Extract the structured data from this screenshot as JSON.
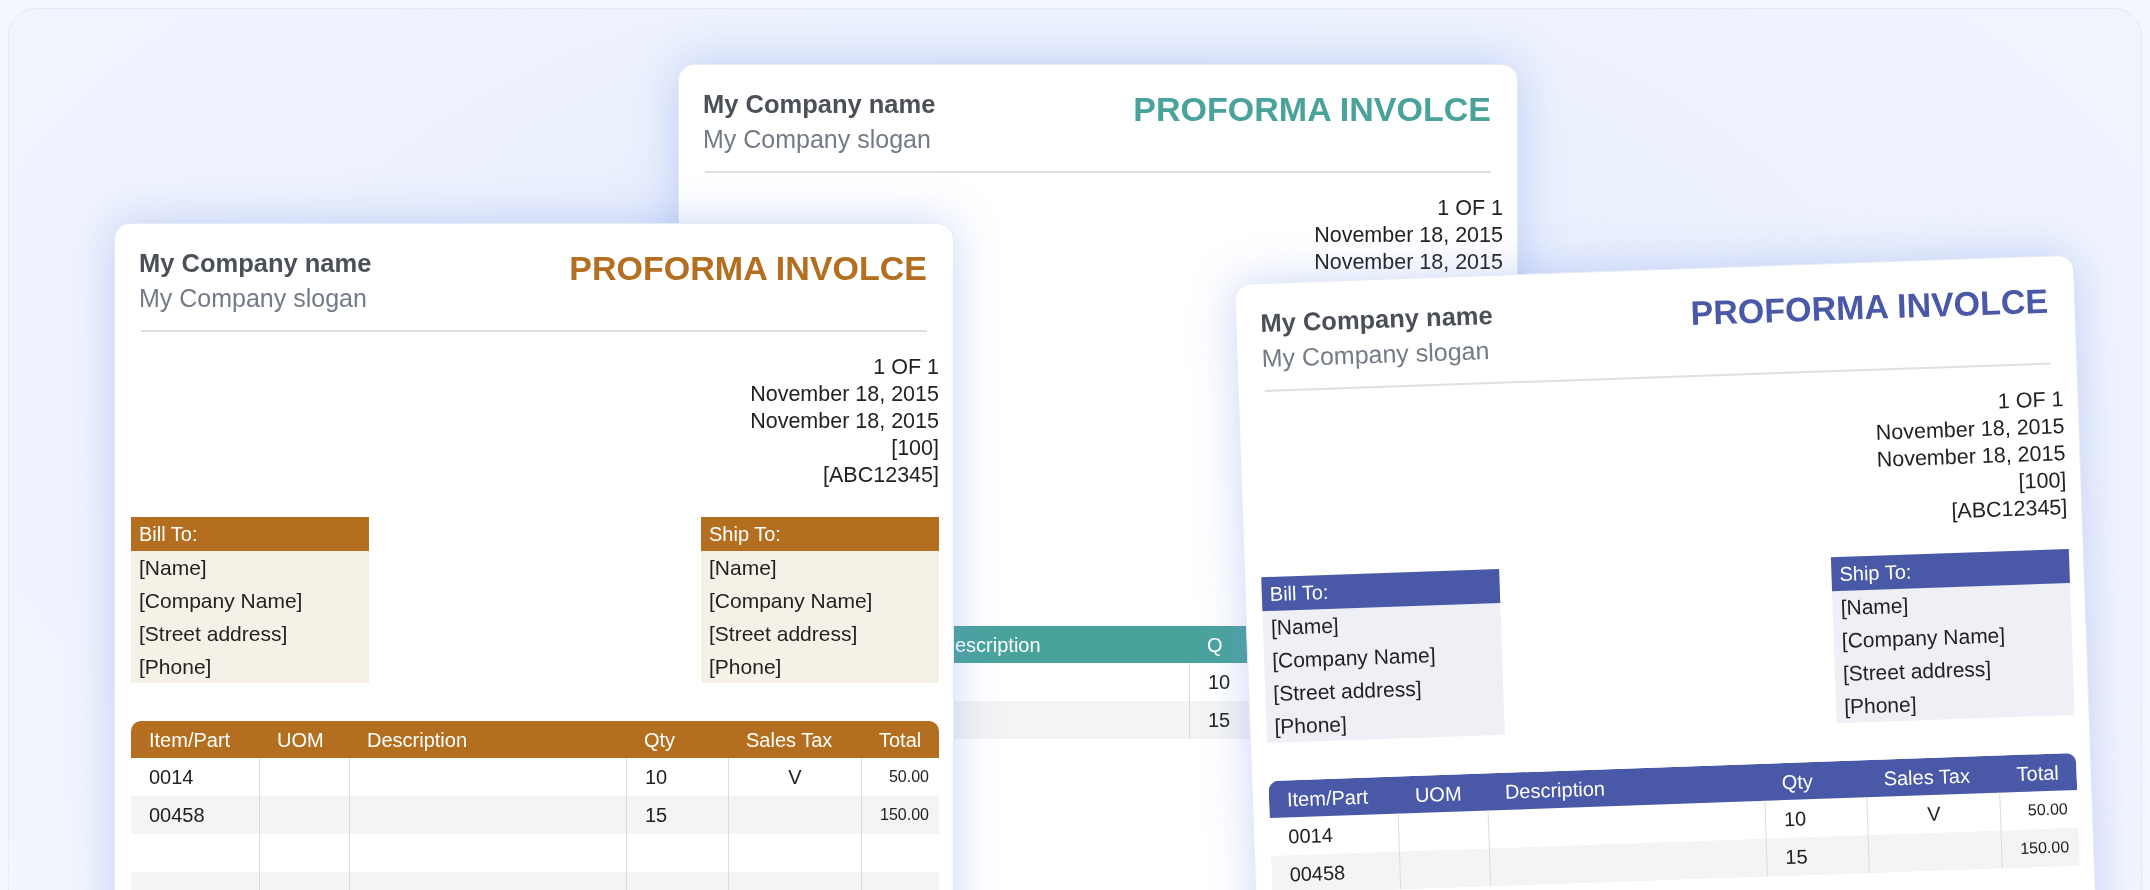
{
  "invoices": [
    {
      "kind": "back",
      "color": "#4aa39b",
      "company_name": "My Company name",
      "slogan": "My Company slogan",
      "title": "PROFORMA INVOLCE",
      "meta": [
        "1 OF 1",
        "November 18, 2015",
        "November 18, 2015"
      ],
      "table": {
        "columns": [
          "escription",
          "Q"
        ],
        "rows": [
          [
            null,
            "10"
          ],
          [
            null,
            "15"
          ]
        ]
      }
    },
    {
      "kind": "front",
      "color": "#b36f1f",
      "company_name": "My Company name",
      "slogan": "My Company slogan",
      "title": "PROFORMA INVOLCE",
      "meta": [
        "1 OF 1",
        "November 18, 2015",
        "November 18, 2015",
        "[100]",
        "[ABC12345]"
      ],
      "bill_to": {
        "heading": "Bill To:",
        "lines": [
          "[Name]",
          "[Company Name]",
          "[Street address]",
          "[Phone]"
        ]
      },
      "ship_to": {
        "heading": "Ship To:",
        "lines": [
          "[Name]",
          "[Company Name]",
          "[Street address]",
          "[Phone]"
        ]
      },
      "table": {
        "columns": [
          "Item/Part",
          "UOM",
          "Description",
          "Qty",
          "Sales Tax",
          "Total"
        ],
        "rows": [
          [
            "0014",
            null,
            null,
            "10",
            "V",
            "50.00"
          ],
          [
            "00458",
            null,
            null,
            "15",
            null,
            "150.00"
          ],
          [
            null,
            null,
            null,
            null,
            null,
            null
          ],
          [
            null,
            null,
            null,
            null,
            null,
            null
          ]
        ]
      }
    },
    {
      "kind": "front",
      "color": "#4a59a7",
      "company_name": "My Company name",
      "slogan": "My Company slogan",
      "title": "PROFORMA INVOLCE",
      "meta": [
        "1 OF 1",
        "November 18, 2015",
        "November 18, 2015",
        "[100]",
        "[ABC12345]"
      ],
      "bill_to": {
        "heading": "Bill To:",
        "lines": [
          "[Name]",
          "[Company Name]",
          "[Street address]",
          "[Phone]"
        ]
      },
      "ship_to": {
        "heading": "Ship To:",
        "lines": [
          "[Name]",
          "[Company Name]",
          "[Street address]",
          "[Phone]"
        ]
      },
      "table": {
        "columns": [
          "Item/Part",
          "UOM",
          "Description",
          "Qty",
          "Sales Tax",
          "Total"
        ],
        "rows": [
          [
            "0014",
            null,
            null,
            "10",
            "V",
            "50.00"
          ],
          [
            "00458",
            null,
            null,
            "15",
            null,
            "150.00"
          ]
        ]
      }
    }
  ]
}
